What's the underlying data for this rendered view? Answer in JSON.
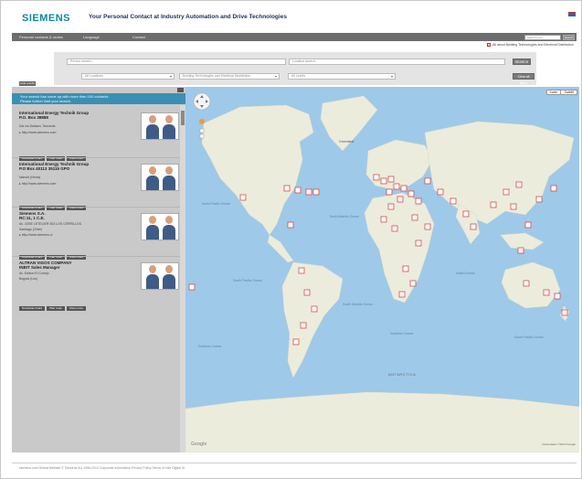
{
  "header": {
    "logo": "SIEMENS",
    "title": "Your Personal Contact at Industry Automation and Drive Technologies"
  },
  "navbar": {
    "items": [
      "Personal contacts & routes",
      "Language",
      "Contact"
    ],
    "search_placeholder": "Search term",
    "search_button": "Search"
  },
  "filter_checkbox": {
    "label": "All about Building Technologies and Electrical Distribution"
  },
  "search": {
    "person_placeholder": "Person search...",
    "location_placeholder": "Location search...",
    "all_locations": "All Locations",
    "division": "Building Technologies and Electrical Distribution",
    "all_levels": "All Levels",
    "search_button": "SEARCH",
    "clear_button": "Clear all filters"
  },
  "leftpanel": {
    "hide_label": "Hide results",
    "notice": [
      "Your search has come up with more than 100 contacts.",
      "Please further limit your search."
    ],
    "results": [
      {
        "name": [
          "International Energy Technik Group",
          "P.O. Box 38888"
        ],
        "lines": [
          "Dar-es-Salaam, Tanzania",
          "http://www.siemens.com"
        ],
        "buttons": [
          "Download vCard",
          "Plan route",
          "Show more"
        ]
      },
      {
        "name": [
          "International Energy Technik Group",
          "P.O Box 40113 35115 GPO"
        ],
        "lines": [
          "Nairobi (Kenia)",
          "http://www.siemens.com"
        ],
        "buttons": [
          "Download vCard",
          "Plan route",
          "Show more"
        ]
      },
      {
        "name": [
          "Siemens S.A.",
          "RC:11, 1 C.E."
        ],
        "lines": [
          "Av. JOSE LETELIER 303 LOS CERRILLOS",
          "Santiago (Chile)",
          "http://www.siemens.cl"
        ],
        "buttons": [
          "Download vCard",
          "Plan route",
          "Show more"
        ]
      },
      {
        "name": [
          "ALTRAN VIGOS COMPANY",
          "INBIT Sales Manager"
        ],
        "lines": [
          "Av. Edison El Conejo",
          "Bogota (Uru)"
        ],
        "buttons": [
          "Download vCard",
          "Plan route",
          "Show more"
        ]
      }
    ]
  },
  "map": {
    "map_button": "Karte",
    "satellite_button": "Satellit",
    "oceans": [
      "North Pacific Ocean",
      "North Atlantic Ocean",
      "South Pacific Ocean",
      "South Atlantic Ocean",
      "Indian Ocean",
      "South Pacific Ocean",
      "Southern Ocean",
      "Southern Ocean"
    ],
    "antarctica": "ANTARCTICA",
    "greenland": "Greenland",
    "google": "Google",
    "credit": "Kartendaten ©2013 Google",
    "colors": {
      "water": "#9fc9e8",
      "land": "#ececdc",
      "marker": "#d64a4a"
    }
  },
  "footer": {
    "links": "siemens.com Global Website   © Siemens AG 1996-2013   Corporate Information   Privacy Policy   Terms of Use   Digital ID"
  }
}
